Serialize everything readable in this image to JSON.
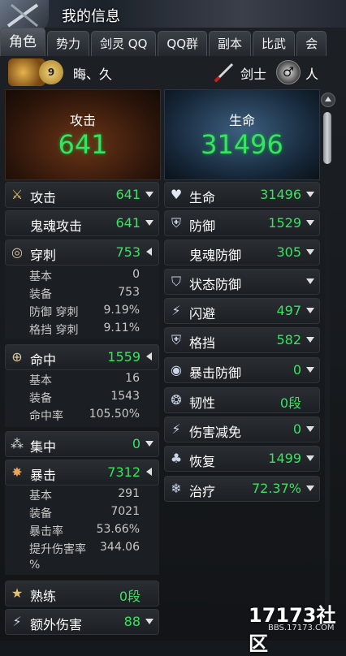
{
  "window": {
    "title": "我的信息"
  },
  "tabs": [
    {
      "label": "角色",
      "active": true
    },
    {
      "label": "势力"
    },
    {
      "label": "剑灵 QQ"
    },
    {
      "label": "QQ群"
    },
    {
      "label": "副本"
    },
    {
      "label": "比武"
    },
    {
      "label": "会"
    }
  ],
  "player": {
    "level": "9",
    "name": "晦、久",
    "class": "剑士",
    "gender": "人"
  },
  "summary": {
    "attack": {
      "label": "攻击",
      "value": "641"
    },
    "life": {
      "label": "生命",
      "value": "31496"
    }
  },
  "left_stats": {
    "attack": {
      "label": "攻击",
      "value": "641"
    },
    "ghost_attack": {
      "label": "鬼魂攻击",
      "value": "641"
    },
    "pierce": {
      "label": "穿刺",
      "value": "753",
      "details": [
        {
          "k": "基本",
          "v": "0"
        },
        {
          "k": "装备",
          "v": "753"
        },
        {
          "k": "防御 穿刺",
          "v": "9.19%"
        },
        {
          "k": "格挡 穿刺",
          "v": "9.11%"
        }
      ]
    },
    "accuracy": {
      "label": "命中",
      "value": "1559",
      "details": [
        {
          "k": "基本",
          "v": "16"
        },
        {
          "k": "装备",
          "v": "1543"
        },
        {
          "k": "命中率",
          "v": "105.50%"
        }
      ]
    },
    "focus": {
      "label": "集中",
      "value": "0"
    },
    "crit": {
      "label": "暴击",
      "value": "7312",
      "details": [
        {
          "k": "基本",
          "v": "291"
        },
        {
          "k": "装备",
          "v": "7021"
        },
        {
          "k": "暴击率",
          "v": "53.66%"
        },
        {
          "k": "提升伤害率",
          "v": "344.06"
        }
      ],
      "wrap": "%"
    },
    "mastery": {
      "label": "熟练",
      "value": "0段"
    },
    "extra_damage": {
      "label": "额外伤害",
      "value": "88"
    }
  },
  "right_stats": {
    "life": {
      "label": "生命",
      "value": "31496"
    },
    "defense": {
      "label": "防御",
      "value": "1529"
    },
    "ghost_defense": {
      "label": "鬼魂防御",
      "value": "305"
    },
    "status_defense": {
      "label": "状态防御",
      "value": ""
    },
    "evasion": {
      "label": "闪避",
      "value": "497"
    },
    "block": {
      "label": "格挡",
      "value": "582"
    },
    "crit_defense": {
      "label": "暴击防御",
      "value": "0"
    },
    "toughness": {
      "label": "韧性",
      "value": "0段"
    },
    "damage_reduce": {
      "label": "伤害减免",
      "value": "0"
    },
    "recovery": {
      "label": "恢复",
      "value": "1499"
    },
    "healing": {
      "label": "治疗",
      "value": "72.37%"
    }
  },
  "watermark": {
    "logo": "17173社区",
    "url": "BBS.17173.COM"
  },
  "colors": {
    "value_green": "#3be160",
    "panel_bg": "#1c1f23",
    "text": "#ffffff"
  }
}
